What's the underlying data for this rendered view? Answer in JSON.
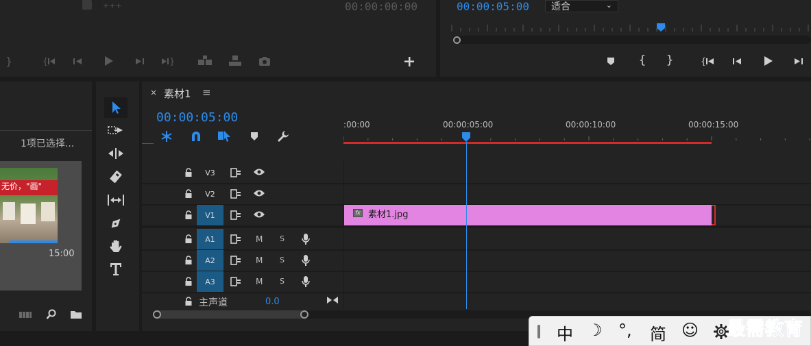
{
  "source_monitor": {
    "timecode": "00:00:00:00",
    "controls": [
      "mark-out",
      "go-to-in",
      "step-back",
      "play",
      "step-forward",
      "go-to-out",
      "insert",
      "overwrite",
      "export-frame",
      "add"
    ]
  },
  "program_monitor": {
    "timecode": "00:00:05:00",
    "fit_select": "适合",
    "playhead_fraction": 0.58,
    "controls": [
      "add-marker",
      "mark-in",
      "mark-out",
      "go-to-in",
      "step-back",
      "play",
      "step-forward"
    ]
  },
  "project": {
    "selection_text": "1项已选择...",
    "thumb_duration": "15:00",
    "thumb_banner": "无价，\"画\""
  },
  "tools": [
    "selection",
    "track-select-forward",
    "ripple-edit",
    "razor",
    "slip",
    "pen",
    "hand",
    "type"
  ],
  "timeline": {
    "sequence_name": "素材1",
    "close_glyph": "×",
    "menu_glyph": "≡",
    "timecode": "00:00:05:00",
    "ruler": [
      "00:00",
      "00:00:05:00",
      "00:00:10:00",
      "00:00:15:00"
    ],
    "ruler_first": ":00:00",
    "playhead_seconds": 5,
    "clip_end_seconds": 15,
    "tracks": {
      "v3": "V3",
      "v2": "V2",
      "v1": "V1",
      "a1": "A1",
      "a2": "A2",
      "a3": "A3"
    },
    "audio_mute": "M",
    "audio_solo": "S",
    "master_label": "主声道",
    "master_value": "0.0",
    "clip": {
      "name": "素材1.jpg",
      "fx": "fx",
      "color": "#e384e3"
    }
  },
  "ime": {
    "keys": [
      "中",
      "☽",
      "°,",
      "简",
      "☺"
    ],
    "brand": "最需教育"
  },
  "colors": {
    "accent_blue": "#2d8ceb",
    "work_area_red": "#d32a2a",
    "track_on": "#1c5a86"
  }
}
